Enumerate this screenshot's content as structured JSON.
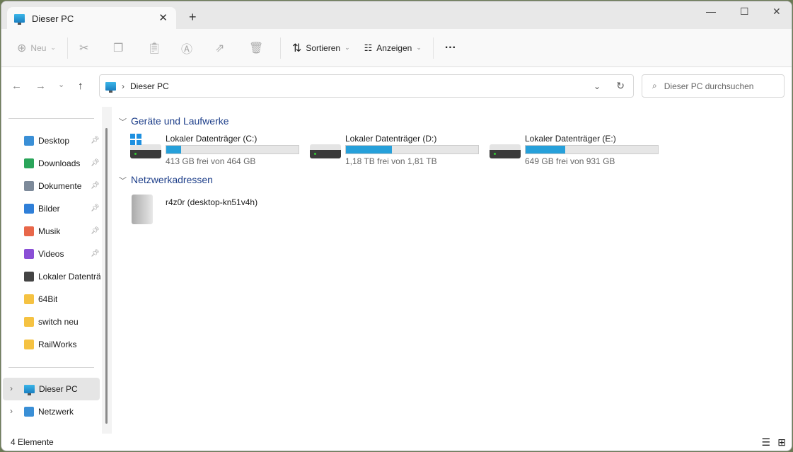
{
  "tab": {
    "title": "Dieser PC"
  },
  "toolbar": {
    "new": "Neu",
    "sort": "Sortieren",
    "view": "Anzeigen",
    "more": "···"
  },
  "address": {
    "path": "Dieser PC"
  },
  "search": {
    "placeholder": "Dieser PC durchsuchen"
  },
  "sidebar": {
    "quick": [
      {
        "label": "Desktop",
        "pinned": true
      },
      {
        "label": "Downloads",
        "pinned": true
      },
      {
        "label": "Dokumente",
        "pinned": true
      },
      {
        "label": "Bilder",
        "pinned": true
      },
      {
        "label": "Musik",
        "pinned": true
      },
      {
        "label": "Videos",
        "pinned": true
      },
      {
        "label": "Lokaler Datenträger",
        "pinned": false
      },
      {
        "label": "64Bit",
        "pinned": false
      },
      {
        "label": "switch neu",
        "pinned": false
      },
      {
        "label": "RailWorks",
        "pinned": false
      }
    ],
    "thispc": "Dieser PC",
    "network": "Netzwerk"
  },
  "groups": {
    "drives": "Geräte und Laufwerke",
    "network": "Netzwerkadressen"
  },
  "drives": [
    {
      "name": "Lokaler Datenträger (C:)",
      "free": "413 GB frei von 464 GB",
      "used_fraction": 0.11
    },
    {
      "name": "Lokaler Datenträger (D:)",
      "free": "1,18 TB frei von 1,81 TB",
      "used_fraction": 0.35
    },
    {
      "name": "Lokaler Datenträger (E:)",
      "free": "649 GB frei von 931 GB",
      "used_fraction": 0.3
    }
  ],
  "netloc": {
    "name": "r4z0r (desktop-kn51v4h)"
  },
  "status": {
    "count": "4 Elemente"
  }
}
